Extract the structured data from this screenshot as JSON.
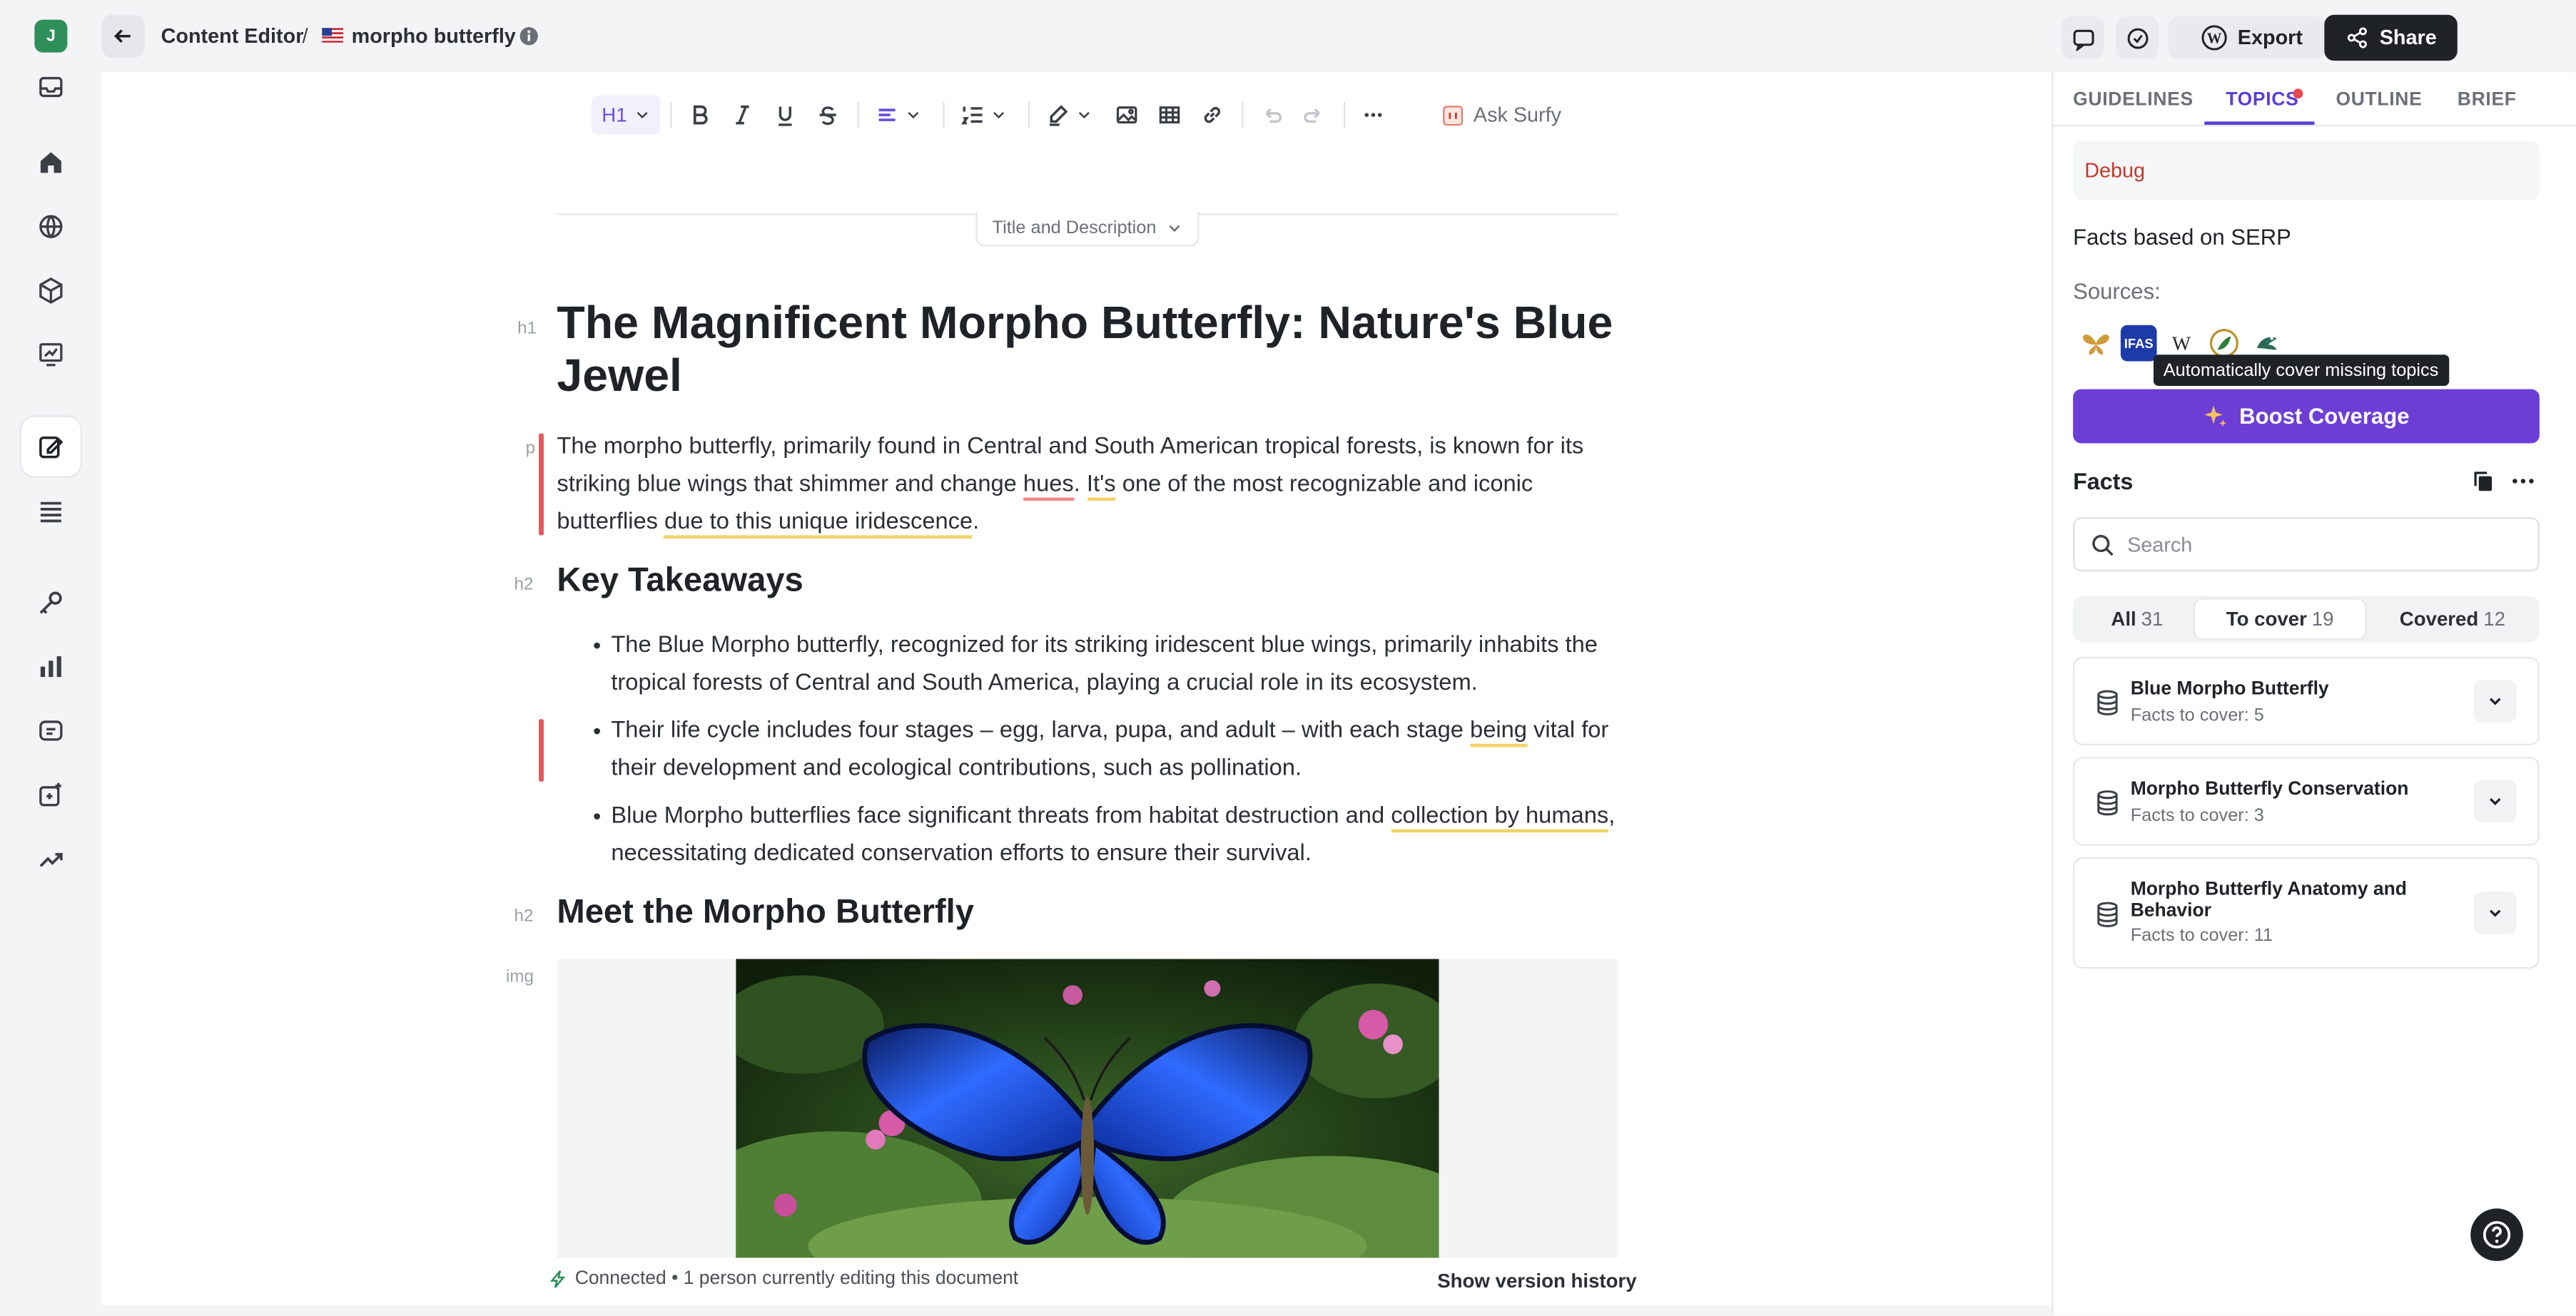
{
  "app": {
    "avatar_letter": "J",
    "breadcrumb_root": "Content Editor",
    "breadcrumb_separator": "/",
    "document_name": "morpho butterfly",
    "export_label": "Export",
    "share_label": "Share"
  },
  "rail": {
    "items": [
      {
        "name": "inbox-icon"
      },
      {
        "name": "home-icon"
      },
      {
        "name": "globe-icon"
      },
      {
        "name": "cube-icon"
      },
      {
        "name": "chart-board-icon"
      },
      {
        "name": "content-editor-icon",
        "active": true
      },
      {
        "name": "list-icon"
      },
      {
        "name": "key-icon"
      },
      {
        "name": "bar-chart-icon"
      },
      {
        "name": "message-icon"
      },
      {
        "name": "ai-sparkle-icon"
      },
      {
        "name": "trend-icon"
      }
    ]
  },
  "toolbar": {
    "heading_label": "H1",
    "ask_surfy": "Ask Surfy"
  },
  "editor": {
    "title_description_toggle": "Title and Description",
    "gutter": {
      "h1": "h1",
      "p": "p",
      "h2": "h2",
      "img": "img"
    },
    "h1": "The Magnificent Morpho Butterfly: Nature's Blue Jewel",
    "intro": {
      "part1": "The morpho butterfly, primarily found in Central and South American tropical forests, is known for its striking blue wings that shimmer and change ",
      "hues": "hues",
      "part2": ". ",
      "its": "It's",
      "part3": " one of the most recognizable and iconic butterflies ",
      "due": "due to this unique iridescence",
      "part4": "."
    },
    "key_takeaways_heading": "Key Takeaways",
    "bullets": [
      {
        "text": "The Blue Morpho butterfly, recognized for its striking iridescent blue wings, primarily inhabits the tropical forests of Central and South America, playing a crucial role in its ecosystem."
      },
      {
        "pre": "Their life cycle includes four stages – egg, larva, pupa, and adult – with each stage ",
        "hl": "being",
        "post": " vital for their development and ecological contributions, such as pollination."
      },
      {
        "pre": "Blue Morpho butterflies face significant threats from habitat destruction and ",
        "hl": "collection by humans",
        "post": ", necessitating dedicated conservation efforts to ensure their survival."
      }
    ],
    "meet_heading": "Meet the Morpho Butterfly",
    "status": "Connected • 1 person currently editing this document",
    "version_history": "Show version history"
  },
  "panel": {
    "tabs": [
      {
        "label": "GUIDELINES"
      },
      {
        "label": "TOPICS",
        "active": true
      },
      {
        "label": "OUTLINE"
      },
      {
        "label": "BRIEF"
      }
    ],
    "debug": "Debug",
    "facts_based": "Facts based on SERP",
    "sources_label": "Sources:",
    "sources": [
      "butterfly-logo",
      "IFAS",
      "W",
      "leaf-logo",
      "frog-logo"
    ],
    "ifas": "IFAS",
    "wiki": "W",
    "tooltip": "Automatically cover missing topics",
    "boost": "Boost Coverage",
    "facts_title": "Facts",
    "search_placeholder": "Search",
    "segments": [
      {
        "label": "All",
        "count": "31"
      },
      {
        "label": "To cover",
        "count": "19",
        "active": true
      },
      {
        "label": "Covered",
        "count": "12"
      }
    ],
    "topics": [
      {
        "name": "Blue Morpho Butterfly",
        "sub": "Facts to cover: 5"
      },
      {
        "name": "Morpho Butterfly Conservation",
        "sub": "Facts to cover: 3"
      },
      {
        "name": "Morpho Butterfly Anatomy and Behavior",
        "sub": "Facts to cover: 11"
      }
    ]
  },
  "colors": {
    "accent": "#5b3ed6",
    "boost": "#6d3ed6",
    "error_bar": "#e35959",
    "highlight_yellow": "#f2d36a"
  }
}
